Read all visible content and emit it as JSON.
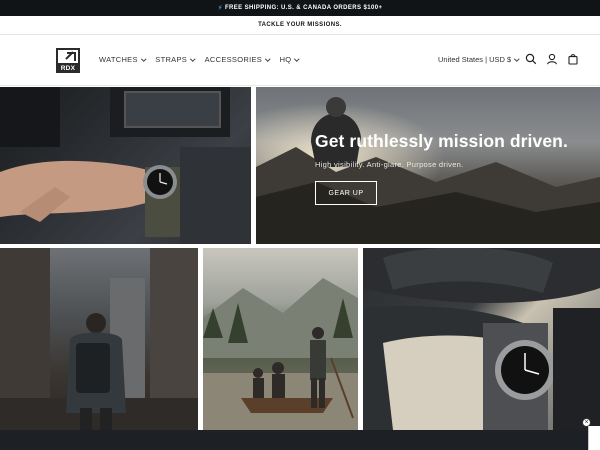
{
  "announcement": {
    "shipping_text": "FREE SHIPPING: U.S. & CANADA ORDERS $100+",
    "tagline": "TACKLE YOUR MISSIONS."
  },
  "logo": {
    "text": "RDX"
  },
  "nav": {
    "items": [
      {
        "label": "WATCHES"
      },
      {
        "label": "STRAPS"
      },
      {
        "label": "ACCESSORIES"
      },
      {
        "label": "HQ"
      }
    ]
  },
  "header": {
    "region": "United States | USD $",
    "icons": [
      "search-icon",
      "account-icon",
      "cart-icon"
    ]
  },
  "hero": {
    "title": "Get ruthlessly mission driven.",
    "subtitle": "High visibility. Anti-glare. Purpose driven.",
    "button": "GEAR UP"
  },
  "colors": {
    "topbar": "#111417",
    "bottom_bar": "#1d2126",
    "text": "#121212"
  }
}
